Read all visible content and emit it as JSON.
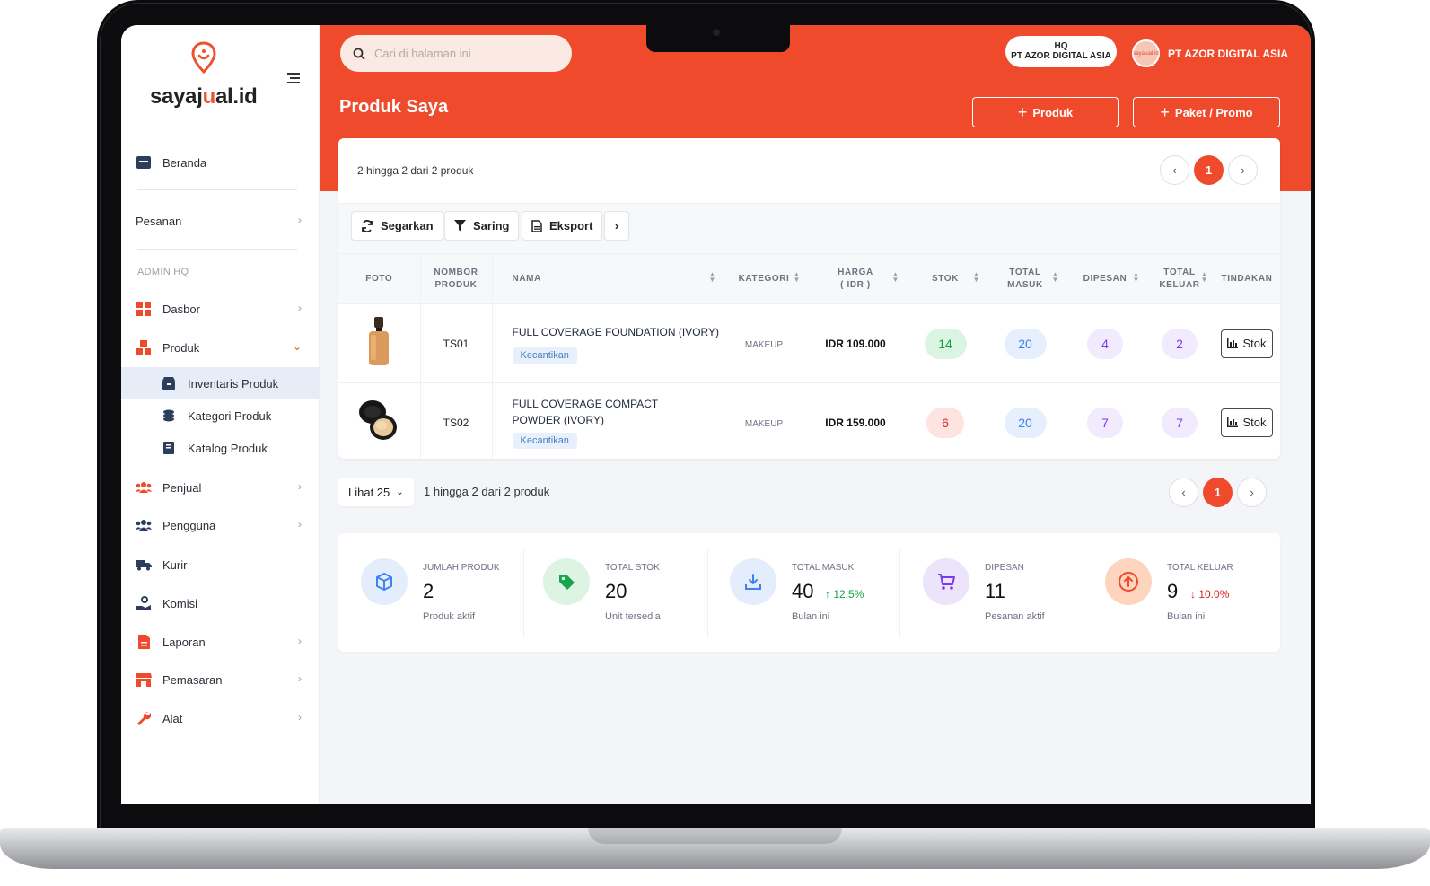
{
  "brand": {
    "name_prefix": "sayaj",
    "name_o": "u",
    "name_mid": "al",
    "name_suffix": ".id"
  },
  "sidebar": {
    "home": "Beranda",
    "orders": "Pesanan",
    "section": "ADMIN HQ",
    "items": [
      {
        "label": "Dasbor"
      },
      {
        "label": "Produk"
      },
      {
        "label": "Penjual"
      },
      {
        "label": "Pengguna"
      },
      {
        "label": "Kurir"
      },
      {
        "label": "Komisi"
      },
      {
        "label": "Laporan"
      },
      {
        "label": "Pemasaran"
      },
      {
        "label": "Alat"
      }
    ],
    "sub": [
      {
        "label": "Inventaris Produk",
        "active": true
      },
      {
        "label": "Kategori Produk"
      },
      {
        "label": "Katalog Produk"
      }
    ]
  },
  "header": {
    "search_placeholder": "Cari di halaman ini",
    "hq_line1": "HQ",
    "hq_line2": "PT AZOR DIGITAL ASIA",
    "user_name": "PT AZOR DIGITAL ASIA",
    "avatar_text": "sayajual.id",
    "page_title": "Produk Saya",
    "btn_product": "Produk",
    "btn_promo": "Paket / Promo"
  },
  "list": {
    "count_top": "2 hingga 2 dari 2 produk",
    "current_page": "1",
    "toolbar": {
      "refresh": "Segarkan",
      "filter": "Saring",
      "export": "Eksport"
    },
    "columns": {
      "foto": "FOTO",
      "nomor_1": "NOMBOR",
      "nomor_2": "PRODUK",
      "nama": "NAMA",
      "kategori": "KATEGORI",
      "harga_1": "HARGA",
      "harga_2": "( IDR )",
      "stok": "STOK",
      "masuk_1": "TOTAL",
      "masuk_2": "MASUK",
      "dipesan": "DIPESAN",
      "keluar_1": "TOTAL",
      "keluar_2": "KELUAR",
      "tindakan": "TINDAKAN"
    },
    "rows": [
      {
        "code": "TS01",
        "name": "FULL COVERAGE FOUNDATION (IVORY)",
        "tag": "Kecantikan",
        "category": "MAKEUP",
        "price": "IDR 109.000",
        "stock": "14",
        "in": "20",
        "ordered": "4",
        "out": "2",
        "action": "Stok"
      },
      {
        "code": "TS02",
        "name": "FULL COVERAGE COMPACT POWDER (IVORY)",
        "tag": "Kecantikan",
        "category": "MAKEUP",
        "price": "IDR 159.000",
        "stock": "6",
        "in": "20",
        "ordered": "7",
        "out": "7",
        "action": "Stok"
      }
    ],
    "view_select": "Lihat 25",
    "count_bottom": "1 hingga 2 dari 2 produk"
  },
  "stats": [
    {
      "label": "JUMLAH PRODUK",
      "value": "2",
      "sub": "Produk aktif",
      "change": ""
    },
    {
      "label": "TOTAL STOK",
      "value": "20",
      "sub": "Unit tersedia",
      "change": ""
    },
    {
      "label": "TOTAL MASUK",
      "value": "40",
      "sub": "Bulan ini",
      "change": "↑ 12.5%"
    },
    {
      "label": "DIPESAN",
      "value": "11",
      "sub": "Pesanan aktif",
      "change": ""
    },
    {
      "label": "TOTAL KELUAR",
      "value": "9",
      "sub": "Bulan ini",
      "change": "↓ 10.0%"
    }
  ],
  "colors": {
    "accent": "#ef4a2c",
    "green": "#16a34a",
    "red": "#dc2626",
    "blue": "#3b82f6",
    "purple": "#7c3aed"
  }
}
